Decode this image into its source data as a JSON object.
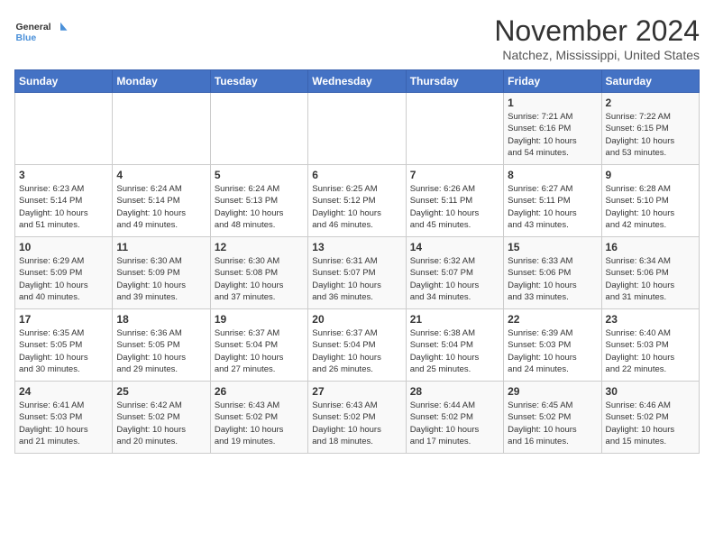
{
  "header": {
    "logo_line1": "General",
    "logo_line2": "Blue",
    "month": "November 2024",
    "location": "Natchez, Mississippi, United States"
  },
  "weekdays": [
    "Sunday",
    "Monday",
    "Tuesday",
    "Wednesday",
    "Thursday",
    "Friday",
    "Saturday"
  ],
  "weeks": [
    [
      {
        "day": "",
        "info": ""
      },
      {
        "day": "",
        "info": ""
      },
      {
        "day": "",
        "info": ""
      },
      {
        "day": "",
        "info": ""
      },
      {
        "day": "",
        "info": ""
      },
      {
        "day": "1",
        "info": "Sunrise: 7:21 AM\nSunset: 6:16 PM\nDaylight: 10 hours\nand 54 minutes."
      },
      {
        "day": "2",
        "info": "Sunrise: 7:22 AM\nSunset: 6:15 PM\nDaylight: 10 hours\nand 53 minutes."
      }
    ],
    [
      {
        "day": "3",
        "info": "Sunrise: 6:23 AM\nSunset: 5:14 PM\nDaylight: 10 hours\nand 51 minutes."
      },
      {
        "day": "4",
        "info": "Sunrise: 6:24 AM\nSunset: 5:14 PM\nDaylight: 10 hours\nand 49 minutes."
      },
      {
        "day": "5",
        "info": "Sunrise: 6:24 AM\nSunset: 5:13 PM\nDaylight: 10 hours\nand 48 minutes."
      },
      {
        "day": "6",
        "info": "Sunrise: 6:25 AM\nSunset: 5:12 PM\nDaylight: 10 hours\nand 46 minutes."
      },
      {
        "day": "7",
        "info": "Sunrise: 6:26 AM\nSunset: 5:11 PM\nDaylight: 10 hours\nand 45 minutes."
      },
      {
        "day": "8",
        "info": "Sunrise: 6:27 AM\nSunset: 5:11 PM\nDaylight: 10 hours\nand 43 minutes."
      },
      {
        "day": "9",
        "info": "Sunrise: 6:28 AM\nSunset: 5:10 PM\nDaylight: 10 hours\nand 42 minutes."
      }
    ],
    [
      {
        "day": "10",
        "info": "Sunrise: 6:29 AM\nSunset: 5:09 PM\nDaylight: 10 hours\nand 40 minutes."
      },
      {
        "day": "11",
        "info": "Sunrise: 6:30 AM\nSunset: 5:09 PM\nDaylight: 10 hours\nand 39 minutes."
      },
      {
        "day": "12",
        "info": "Sunrise: 6:30 AM\nSunset: 5:08 PM\nDaylight: 10 hours\nand 37 minutes."
      },
      {
        "day": "13",
        "info": "Sunrise: 6:31 AM\nSunset: 5:07 PM\nDaylight: 10 hours\nand 36 minutes."
      },
      {
        "day": "14",
        "info": "Sunrise: 6:32 AM\nSunset: 5:07 PM\nDaylight: 10 hours\nand 34 minutes."
      },
      {
        "day": "15",
        "info": "Sunrise: 6:33 AM\nSunset: 5:06 PM\nDaylight: 10 hours\nand 33 minutes."
      },
      {
        "day": "16",
        "info": "Sunrise: 6:34 AM\nSunset: 5:06 PM\nDaylight: 10 hours\nand 31 minutes."
      }
    ],
    [
      {
        "day": "17",
        "info": "Sunrise: 6:35 AM\nSunset: 5:05 PM\nDaylight: 10 hours\nand 30 minutes."
      },
      {
        "day": "18",
        "info": "Sunrise: 6:36 AM\nSunset: 5:05 PM\nDaylight: 10 hours\nand 29 minutes."
      },
      {
        "day": "19",
        "info": "Sunrise: 6:37 AM\nSunset: 5:04 PM\nDaylight: 10 hours\nand 27 minutes."
      },
      {
        "day": "20",
        "info": "Sunrise: 6:37 AM\nSunset: 5:04 PM\nDaylight: 10 hours\nand 26 minutes."
      },
      {
        "day": "21",
        "info": "Sunrise: 6:38 AM\nSunset: 5:04 PM\nDaylight: 10 hours\nand 25 minutes."
      },
      {
        "day": "22",
        "info": "Sunrise: 6:39 AM\nSunset: 5:03 PM\nDaylight: 10 hours\nand 24 minutes."
      },
      {
        "day": "23",
        "info": "Sunrise: 6:40 AM\nSunset: 5:03 PM\nDaylight: 10 hours\nand 22 minutes."
      }
    ],
    [
      {
        "day": "24",
        "info": "Sunrise: 6:41 AM\nSunset: 5:03 PM\nDaylight: 10 hours\nand 21 minutes."
      },
      {
        "day": "25",
        "info": "Sunrise: 6:42 AM\nSunset: 5:02 PM\nDaylight: 10 hours\nand 20 minutes."
      },
      {
        "day": "26",
        "info": "Sunrise: 6:43 AM\nSunset: 5:02 PM\nDaylight: 10 hours\nand 19 minutes."
      },
      {
        "day": "27",
        "info": "Sunrise: 6:43 AM\nSunset: 5:02 PM\nDaylight: 10 hours\nand 18 minutes."
      },
      {
        "day": "28",
        "info": "Sunrise: 6:44 AM\nSunset: 5:02 PM\nDaylight: 10 hours\nand 17 minutes."
      },
      {
        "day": "29",
        "info": "Sunrise: 6:45 AM\nSunset: 5:02 PM\nDaylight: 10 hours\nand 16 minutes."
      },
      {
        "day": "30",
        "info": "Sunrise: 6:46 AM\nSunset: 5:02 PM\nDaylight: 10 hours\nand 15 minutes."
      }
    ]
  ]
}
